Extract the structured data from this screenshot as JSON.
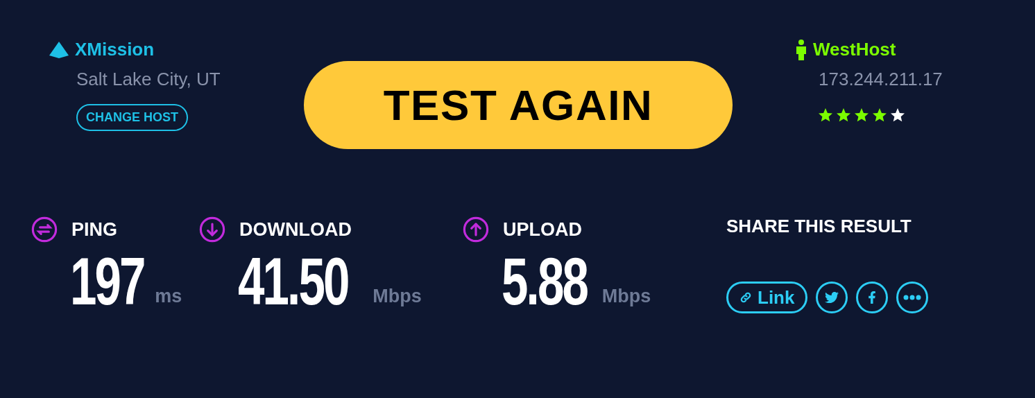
{
  "isp": {
    "name": "XMission",
    "location": "Salt Lake City, UT",
    "change_button": "CHANGE HOST"
  },
  "test_button": "TEST AGAIN",
  "server": {
    "name": "WestHost",
    "ip": "173.244.211.17",
    "stars": 4
  },
  "metrics": [
    {
      "kind": "ping",
      "label": "PING",
      "value": "197",
      "unit": "ms"
    },
    {
      "kind": "download",
      "label": "DOWNLOAD",
      "value": "41.50",
      "unit": "Mbps"
    },
    {
      "kind": "upload",
      "label": "UPLOAD",
      "value": "5.88",
      "unit": "Mbps"
    }
  ],
  "share": {
    "title": "SHARE THIS RESULT",
    "link_button": "Link"
  }
}
